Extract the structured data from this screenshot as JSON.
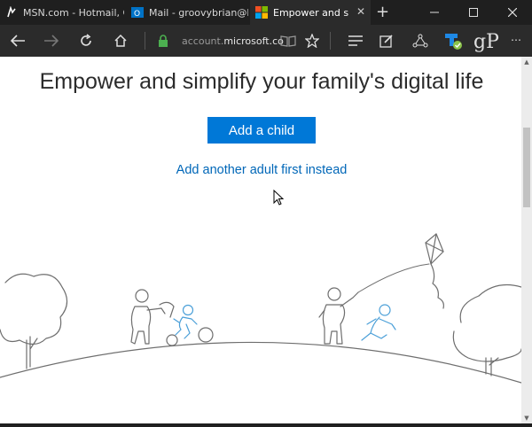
{
  "browser": {
    "tabs": [
      {
        "label": "MSN.com - Hotmail, C",
        "icon": "msn-icon"
      },
      {
        "label": "Mail - groovybrian@liv",
        "icon": "outlook-icon"
      },
      {
        "label": "Empower and simpl",
        "icon": "microsoft-icon",
        "active": true
      }
    ],
    "url_prefix": "account.",
    "url_domain": "microsoft.co",
    "accent_color": "#0078d7"
  },
  "page": {
    "headline": "Empower and simplify your family's digital life",
    "primary_button": "Add a child",
    "secondary_link": "Add another adult first instead"
  }
}
